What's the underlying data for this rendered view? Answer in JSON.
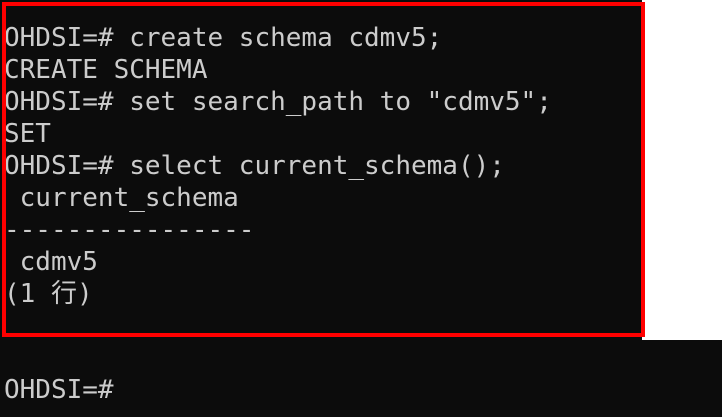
{
  "terminal": {
    "lines": [
      "OHDSI=# create schema cdmv5;",
      "CREATE SCHEMA",
      "OHDSI=# set search_path to \"cdmv5\";",
      "SET",
      "OHDSI=# select current_schema();",
      " current_schema",
      "----------------",
      " cdmv5",
      "(1 行)"
    ],
    "prompt": "OHDSI=#"
  },
  "colors": {
    "background": "#0c0c0c",
    "text": "#cccccc",
    "highlight": "#ff0000"
  }
}
